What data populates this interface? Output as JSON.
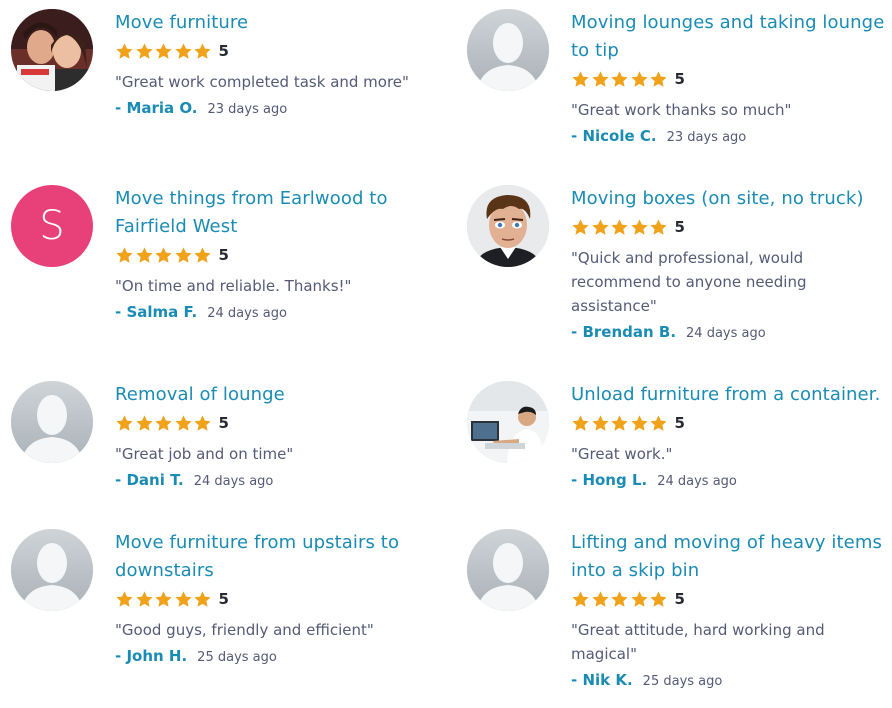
{
  "reviews": [
    {
      "title": "Move furniture",
      "score": "5",
      "quote": "\"Great work completed task and more\"",
      "author": "- Maria O.",
      "time": "23 days ago",
      "avatar": "photo-couple-icon"
    },
    {
      "title": "Moving lounges and taking lounge to tip",
      "score": "5",
      "quote": "\"Great work thanks so much\"",
      "author": "- Nicole C.",
      "time": "23 days ago",
      "avatar": "default-avatar-icon"
    },
    {
      "title": "Move things from Earlwood to Fairfield West",
      "score": "5",
      "quote": "\"On time and reliable. Thanks!\"",
      "author": "- Salma F.",
      "time": "24 days ago",
      "avatar": "letter-avatar",
      "avatar_letter": "S"
    },
    {
      "title": "Moving boxes (on site, no truck)",
      "score": "5",
      "quote": "\"Quick and professional, would recommend to anyone needing assistance\"",
      "author": "- Brendan B.",
      "time": "24 days ago",
      "avatar": "cartoon-face-icon"
    },
    {
      "title": "Removal of lounge",
      "score": "5",
      "quote": "\"Great job and on time\"",
      "author": "- Dani T.",
      "time": "24 days ago",
      "avatar": "default-avatar-icon"
    },
    {
      "title": "Unload furniture from a container.",
      "score": "5",
      "quote": "\"Great work.\"",
      "author": "- Hong L.",
      "time": "24 days ago",
      "avatar": "photo-man-laptop-icon"
    },
    {
      "title": "Move furniture from upstairs to downstairs",
      "score": "5",
      "quote": "\"Good guys, friendly and efficient\"",
      "author": "- John H.",
      "time": "25 days ago",
      "avatar": "default-avatar-icon"
    },
    {
      "title": "Lifting and moving of heavy items into a skip bin",
      "score": "5",
      "quote": "\"Great attitude, hard working and magical\"",
      "author": "- Nik K.",
      "time": "25 days ago",
      "avatar": "default-avatar-icon"
    }
  ],
  "colors": {
    "accent": "#1a8bb3",
    "star": "#f0a21b",
    "text": "#545a77",
    "letter_avatar": "#e8417a"
  }
}
